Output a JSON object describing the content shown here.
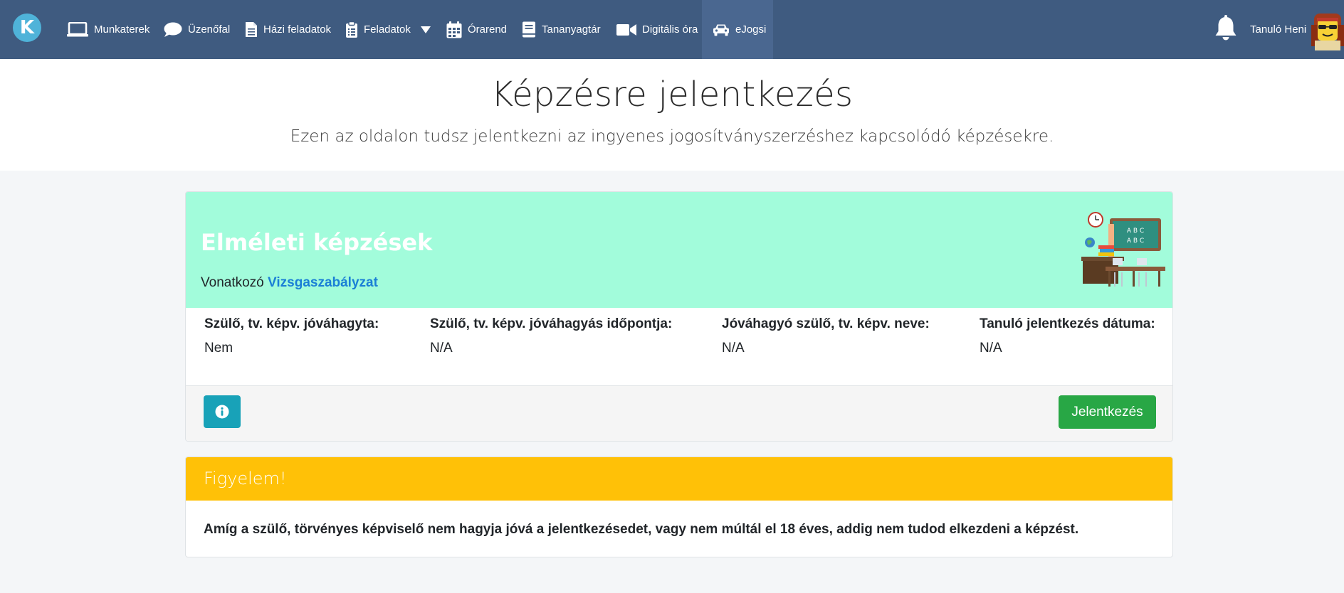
{
  "nav": {
    "logo_letter": "K",
    "items": [
      {
        "label": "Munkaterek",
        "icon": "laptop-icon"
      },
      {
        "label": "Üzenőfal",
        "icon": "chat-bubble-icon"
      },
      {
        "label": "Házi feladatok",
        "icon": "document-icon"
      },
      {
        "label": "Feladatok",
        "icon": "clipboard-icon"
      },
      {
        "label": "Órarend",
        "icon": "calendar-icon"
      },
      {
        "label": "Tananyagtár",
        "icon": "book-icon"
      },
      {
        "label": "Digitális óra",
        "icon": "video-camera-icon"
      },
      {
        "label": "eJogsi",
        "icon": "car-icon",
        "active": true
      }
    ],
    "user_name": "Tanuló Heni"
  },
  "header": {
    "title": "Képzésre jelentkezés",
    "subtitle": "Ezen az oldalon tudsz jelentkezni az ingyenes jogosítványszerzéshez kapcsolódó képzésekre."
  },
  "theory_card": {
    "title": "Elméleti képzések",
    "related_prefix": "Vonatkozó",
    "related_link": "Vizsgaszabályzat",
    "illustration_text_1": "A B C",
    "illustration_text_2": "A B C",
    "fields": [
      {
        "label": "Szülő, tv. képv. jóváhagyta:",
        "value": "Nem"
      },
      {
        "label": "Szülő, tv. képv. jóváhagyás időpontja:",
        "value": "N/A"
      },
      {
        "label": "Jóváhagyó szülő, tv. képv. neve:",
        "value": "N/A"
      },
      {
        "label": "Tanuló jelentkezés dátuma:",
        "value": "N/A"
      }
    ],
    "apply_label": "Jelentkezés"
  },
  "warning_card": {
    "title": "Figyelem!",
    "text": "Amíg a szülő, törvényes képviselő nem hagyja jóvá a jelentkezésedet, vagy nem múltál el 18 éves, addig nem tudod elkezdeni a képzést."
  },
  "colors": {
    "navbar": "#3f5b80",
    "theory_header": "#a2fcdb",
    "warning_header": "#ffc107",
    "apply_button": "#28a745",
    "info_button": "#18a2b8",
    "link": "#1a7fd6"
  }
}
